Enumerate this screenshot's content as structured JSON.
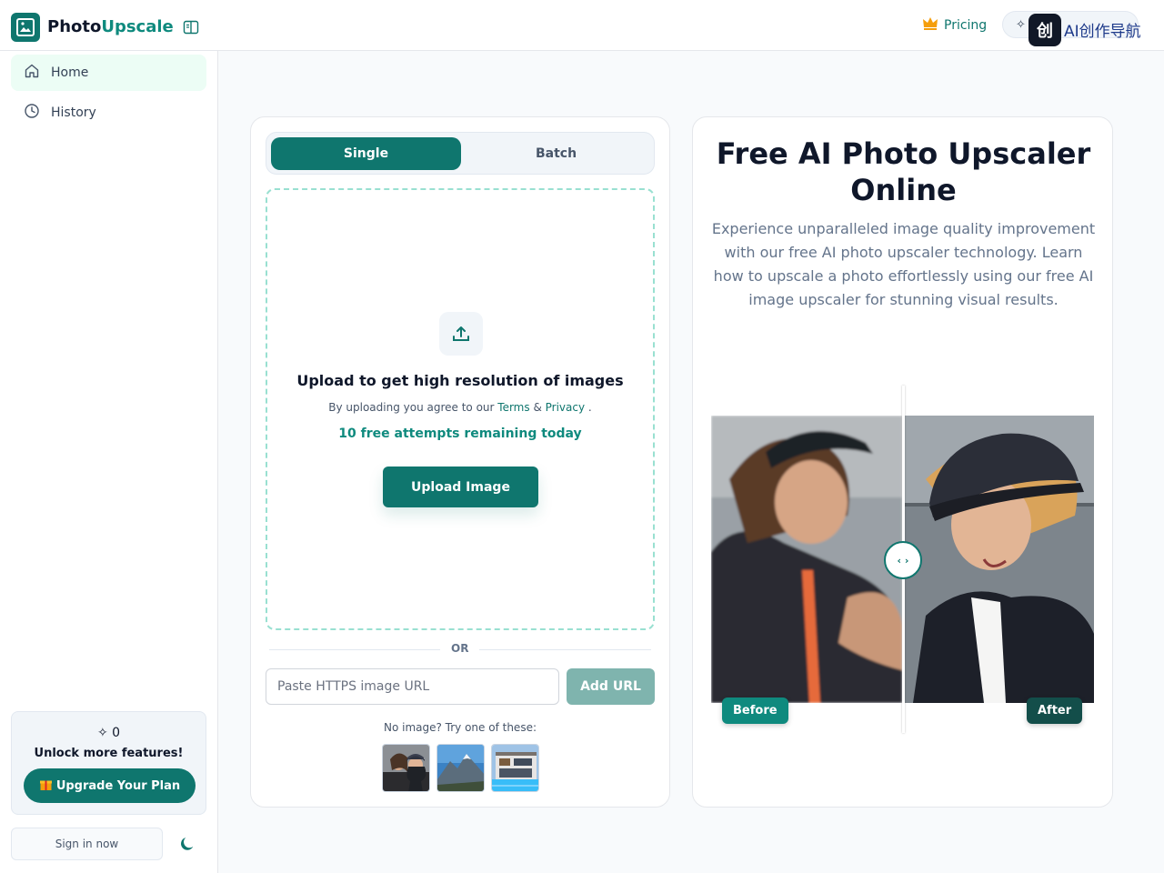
{
  "header": {
    "brand_part1": "Photo",
    "brand_part2": "Upscale",
    "pricing_label": "Pricing",
    "overlay_text": "AI创作导航"
  },
  "sidebar": {
    "items": [
      {
        "label": "Home",
        "icon": "home-icon",
        "active": true
      },
      {
        "label": "History",
        "icon": "clock-icon",
        "active": false
      }
    ],
    "promo": {
      "credits": "0",
      "unlock_text": "Unlock more features!",
      "upgrade_label": "Upgrade Your Plan"
    },
    "signin_label": "Sign in now"
  },
  "upload": {
    "tabs": [
      {
        "label": "Single",
        "active": true
      },
      {
        "label": "Batch",
        "active": false
      }
    ],
    "dropzone_title": "Upload to get high resolution of images",
    "terms_prefix": "By uploading you agree to our",
    "terms_link": "Terms",
    "terms_and": "&",
    "privacy_link": "Privacy",
    "terms_suffix": ".",
    "free_attempts": "10 free attempts remaining today",
    "upload_button": "Upload Image",
    "or_label": "OR",
    "url_placeholder": "Paste HTTPS image URL",
    "add_url_button": "Add URL",
    "samples_label": "No image? Try one of these:"
  },
  "hero": {
    "title": "Free AI Photo Upscaler Online",
    "subtitle": "Experience unparalleled image quality improvement with our free AI photo upscaler technology. Learn how to upscale a photo effortlessly using our free AI image upscaler for stunning visual results.",
    "before_label": "Before",
    "after_label": "After",
    "handle_glyph": "‹ ›"
  },
  "colors": {
    "brand_primary": "#0f766e",
    "brand_accent": "#0f8a7e",
    "dropzone_border": "#99e0d1"
  }
}
